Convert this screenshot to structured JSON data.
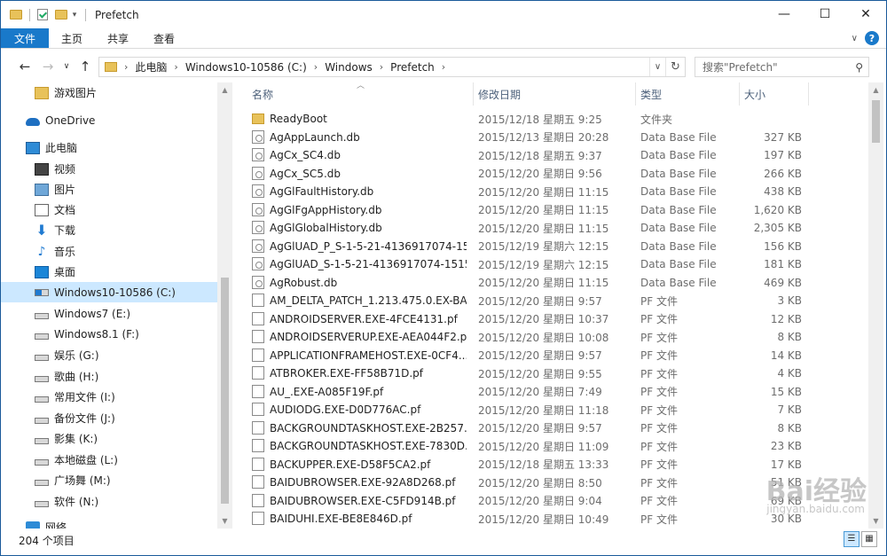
{
  "window": {
    "title": "Prefetch",
    "controls": {
      "minimize": "—",
      "maximize": "☐",
      "close": "✕"
    }
  },
  "ribbon": {
    "file": "文件",
    "tabs": [
      "主页",
      "共享",
      "查看"
    ],
    "expand": "∨",
    "help": "?"
  },
  "nav_buttons": {
    "back": "←",
    "forward": "→",
    "recent": "∨",
    "up": "↑"
  },
  "address": {
    "crumbs": [
      "此电脑",
      "Windows10-10586 (C:)",
      "Windows",
      "Prefetch"
    ],
    "separator": "›",
    "dropdown": "∨",
    "refresh": "↻"
  },
  "search": {
    "placeholder": "搜索\"Prefetch\"",
    "icon": "search-icon"
  },
  "sidebar": {
    "items": [
      {
        "label": "游戏图片",
        "icon": "folder-icon"
      },
      {
        "label": "OneDrive",
        "icon": "cloud-icon"
      },
      {
        "label": "此电脑",
        "icon": "computer-icon"
      },
      {
        "label": "视频",
        "icon": "video-icon"
      },
      {
        "label": "图片",
        "icon": "pictures-icon"
      },
      {
        "label": "文档",
        "icon": "documents-icon"
      },
      {
        "label": "下载",
        "icon": "download-icon"
      },
      {
        "label": "音乐",
        "icon": "music-icon"
      },
      {
        "label": "桌面",
        "icon": "desktop-icon"
      },
      {
        "label": "Windows10-10586 (C:)",
        "icon": "windows-drive-icon",
        "selected": true
      },
      {
        "label": "Windows7 (E:)",
        "icon": "drive-icon"
      },
      {
        "label": "Windows8.1 (F:)",
        "icon": "drive-icon"
      },
      {
        "label": "娱乐 (G:)",
        "icon": "drive-icon"
      },
      {
        "label": "歌曲 (H:)",
        "icon": "drive-icon"
      },
      {
        "label": "常用文件 (I:)",
        "icon": "drive-icon"
      },
      {
        "label": "备份文件 (J:)",
        "icon": "drive-icon"
      },
      {
        "label": "影集 (K:)",
        "icon": "drive-icon"
      },
      {
        "label": "本地磁盘 (L:)",
        "icon": "drive-icon"
      },
      {
        "label": "广场舞 (M:)",
        "icon": "drive-icon"
      },
      {
        "label": "软件 (N:)",
        "icon": "drive-icon"
      },
      {
        "label": "网络",
        "icon": "network-icon"
      }
    ]
  },
  "columns": {
    "name": "名称",
    "date": "修改日期",
    "type": "类型",
    "size": "大小"
  },
  "files": [
    {
      "name": "ReadyBoot",
      "date": "2015/12/18 星期五 9:25",
      "type": "文件夹",
      "size": "",
      "kind": "folder"
    },
    {
      "name": "AgAppLaunch.db",
      "date": "2015/12/13 星期日 20:28",
      "type": "Data Base File",
      "size": "327 KB",
      "kind": "db"
    },
    {
      "name": "AgCx_SC4.db",
      "date": "2015/12/18 星期五 9:37",
      "type": "Data Base File",
      "size": "197 KB",
      "kind": "db"
    },
    {
      "name": "AgCx_SC5.db",
      "date": "2015/12/20 星期日 9:56",
      "type": "Data Base File",
      "size": "266 KB",
      "kind": "db"
    },
    {
      "name": "AgGlFaultHistory.db",
      "date": "2015/12/20 星期日 11:15",
      "type": "Data Base File",
      "size": "438 KB",
      "kind": "db"
    },
    {
      "name": "AgGlFgAppHistory.db",
      "date": "2015/12/20 星期日 11:15",
      "type": "Data Base File",
      "size": "1,620 KB",
      "kind": "db"
    },
    {
      "name": "AgGlGlobalHistory.db",
      "date": "2015/12/20 星期日 11:15",
      "type": "Data Base File",
      "size": "2,305 KB",
      "kind": "db"
    },
    {
      "name": "AgGlUAD_P_S-1-5-21-4136917074-15...",
      "date": "2015/12/19 星期六 12:15",
      "type": "Data Base File",
      "size": "156 KB",
      "kind": "db"
    },
    {
      "name": "AgGlUAD_S-1-5-21-4136917074-1515...",
      "date": "2015/12/19 星期六 12:15",
      "type": "Data Base File",
      "size": "181 KB",
      "kind": "db"
    },
    {
      "name": "AgRobust.db",
      "date": "2015/12/20 星期日 11:15",
      "type": "Data Base File",
      "size": "469 KB",
      "kind": "db"
    },
    {
      "name": "AM_DELTA_PATCH_1.213.475.0.EX-BA...",
      "date": "2015/12/20 星期日 9:57",
      "type": "PF 文件",
      "size": "3 KB",
      "kind": "pf"
    },
    {
      "name": "ANDROIDSERVER.EXE-4FCE4131.pf",
      "date": "2015/12/20 星期日 10:37",
      "type": "PF 文件",
      "size": "12 KB",
      "kind": "pf"
    },
    {
      "name": "ANDROIDSERVERUP.EXE-AEA044F2.pf",
      "date": "2015/12/20 星期日 10:08",
      "type": "PF 文件",
      "size": "8 KB",
      "kind": "pf"
    },
    {
      "name": "APPLICATIONFRAMEHOST.EXE-0CF4...",
      "date": "2015/12/20 星期日 9:57",
      "type": "PF 文件",
      "size": "14 KB",
      "kind": "pf"
    },
    {
      "name": "ATBROKER.EXE-FF58B71D.pf",
      "date": "2015/12/20 星期日 9:55",
      "type": "PF 文件",
      "size": "4 KB",
      "kind": "pf"
    },
    {
      "name": "AU_.EXE-A085F19F.pf",
      "date": "2015/12/20 星期日 7:49",
      "type": "PF 文件",
      "size": "15 KB",
      "kind": "pf"
    },
    {
      "name": "AUDIODG.EXE-D0D776AC.pf",
      "date": "2015/12/20 星期日 11:18",
      "type": "PF 文件",
      "size": "7 KB",
      "kind": "pf"
    },
    {
      "name": "BACKGROUNDTASKHOST.EXE-2B257...",
      "date": "2015/12/20 星期日 9:57",
      "type": "PF 文件",
      "size": "8 KB",
      "kind": "pf"
    },
    {
      "name": "BACKGROUNDTASKHOST.EXE-7830D...",
      "date": "2015/12/20 星期日 11:09",
      "type": "PF 文件",
      "size": "23 KB",
      "kind": "pf"
    },
    {
      "name": "BACKUPPER.EXE-D58F5CA2.pf",
      "date": "2015/12/18 星期五 13:33",
      "type": "PF 文件",
      "size": "17 KB",
      "kind": "pf"
    },
    {
      "name": "BAIDUBROWSER.EXE-92A8D268.pf",
      "date": "2015/12/20 星期日 8:50",
      "type": "PF 文件",
      "size": "51 KB",
      "kind": "pf"
    },
    {
      "name": "BAIDUBROWSER.EXE-C5FD914B.pf",
      "date": "2015/12/20 星期日 9:04",
      "type": "PF 文件",
      "size": "69 KB",
      "kind": "pf"
    },
    {
      "name": "BAIDUHI.EXE-BE8E846D.pf",
      "date": "2015/12/20 星期日 10:49",
      "type": "PF 文件",
      "size": "30 KB",
      "kind": "pf"
    }
  ],
  "status": {
    "count": "204 个项目"
  },
  "watermark": {
    "text": "Bai经验",
    "sub": "jingyan.baidu.com"
  }
}
